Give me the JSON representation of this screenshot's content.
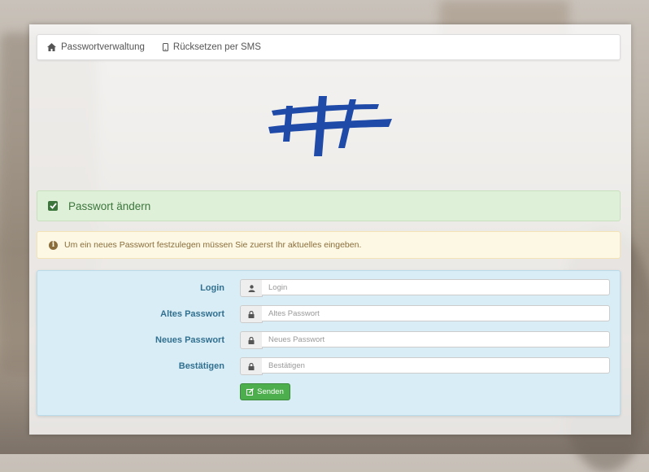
{
  "nav": {
    "items": [
      {
        "label": "Passwortverwaltung",
        "icon": "home-icon"
      },
      {
        "label": "Rücksetzen per SMS",
        "icon": "mobile-icon"
      }
    ]
  },
  "logo": {
    "icon": "school-logo",
    "color": "#1f4aa8"
  },
  "alert_success": {
    "title": "Passwort ändern",
    "icon": "check-square-icon",
    "color": "#3c763d"
  },
  "alert_warning": {
    "text": "Um ein neues Passwort festzulegen müssen Sie zuerst Ihr aktuelles eingeben.",
    "icon": "info-circle-icon",
    "color": "#8a6d3b"
  },
  "form": {
    "fields": [
      {
        "label": "Login",
        "placeholder": "Login",
        "icon": "user-icon"
      },
      {
        "label": "Altes Passwort",
        "placeholder": "Altes Passwort",
        "icon": "lock-icon"
      },
      {
        "label": "Neues Passwort",
        "placeholder": "Neues Passwort",
        "icon": "lock-icon"
      },
      {
        "label": "Bestätigen",
        "placeholder": "Bestätigen",
        "icon": "lock-icon"
      }
    ],
    "submit_label": "Senden",
    "submit_icon": "edit-square-icon",
    "accent": "#31708f",
    "button_color": "#4cae4c"
  }
}
